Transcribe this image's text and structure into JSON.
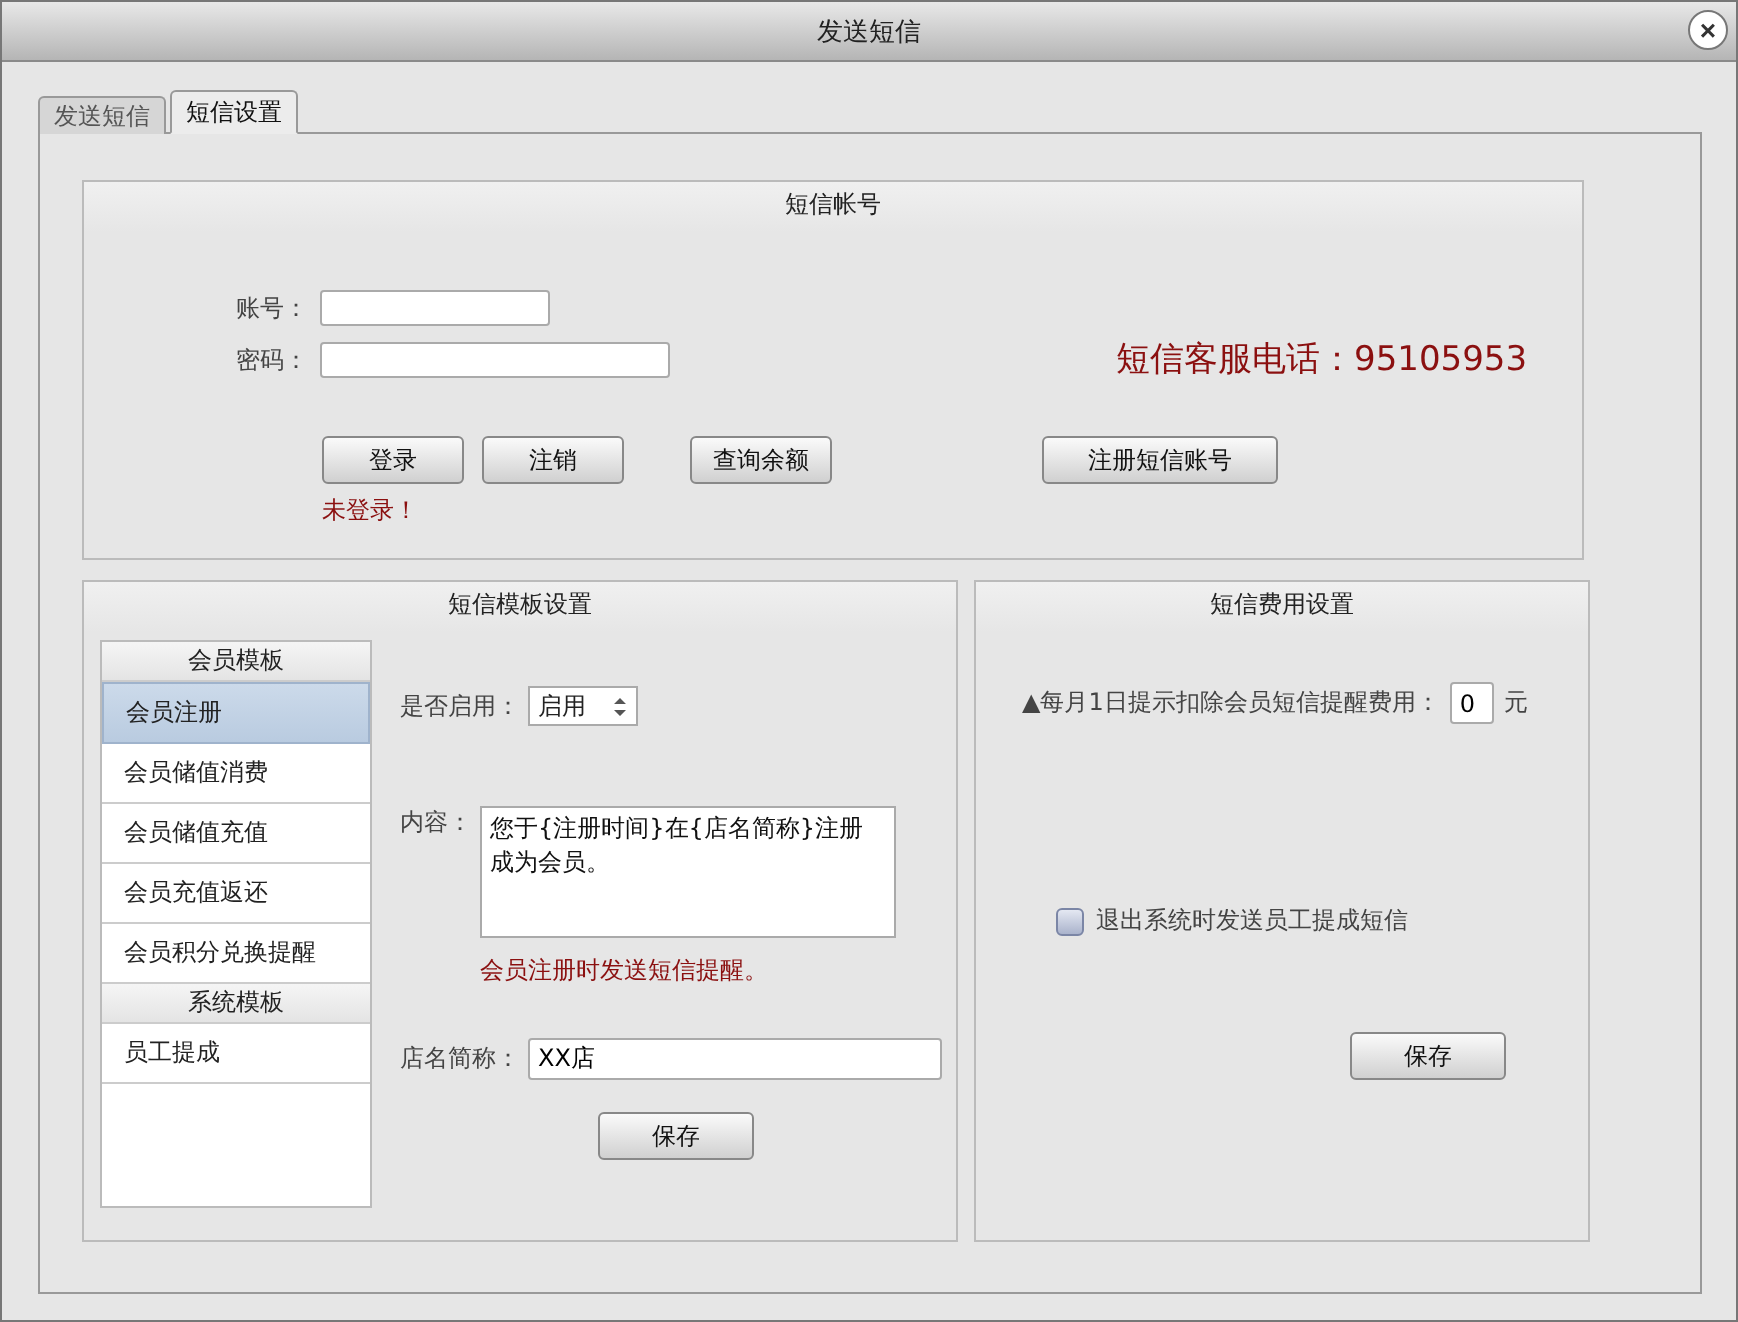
{
  "window": {
    "title": "发送短信",
    "close": "×"
  },
  "tabs": [
    {
      "label": "发送短信",
      "selected": false
    },
    {
      "label": "短信设置",
      "selected": true
    }
  ],
  "account": {
    "title": "短信帐号",
    "fields": [
      {
        "label": "账号："
      },
      {
        "label": "密码："
      }
    ],
    "hotline": "短信客服电话：95105953",
    "buttons": [
      "登录",
      "注销",
      "查询余额"
    ],
    "register_button": "注册短信账号",
    "status": "未登录！"
  },
  "templates": {
    "title": "短信模板设置",
    "groups": [
      {
        "header": "会员模板",
        "items": [
          {
            "label": "会员注册",
            "selected": true
          },
          {
            "label": "会员储值消费",
            "selected": false
          },
          {
            "label": "会员储值充值",
            "selected": false
          },
          {
            "label": "会员充值返还",
            "selected": false
          },
          {
            "label": "会员积分兑换提醒",
            "selected": false
          }
        ]
      },
      {
        "header": "系统模板",
        "items": [
          {
            "label": "员工提成",
            "selected": false
          }
        ]
      }
    ],
    "enabled_label": "是否启用：",
    "enabled_value": "启用",
    "content_label": "内容：",
    "content": "您于{注册时间}在{店名简称}注册成为会员。",
    "hint": "会员注册时发送短信提醒。",
    "shop_label": "店名简称：",
    "shop_value": "XX店",
    "save": "保存"
  },
  "fees": {
    "title": "短信费用设置",
    "fee_label": "▲每月1日提示扣除会员短信提醒费用：",
    "fee_value": "0",
    "unit": "元",
    "checkbox": {
      "label": "退出系统时发送员工提成短信",
      "checked": false
    },
    "save": "保存"
  }
}
